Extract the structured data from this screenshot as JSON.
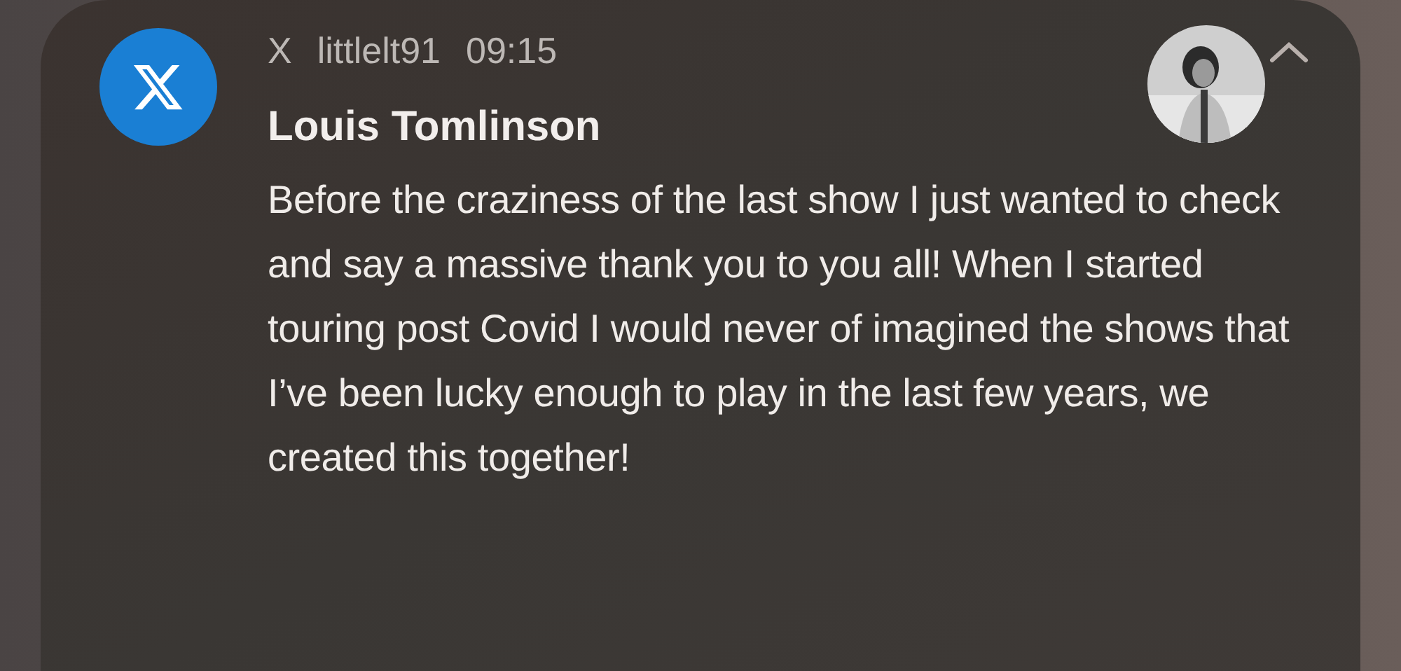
{
  "notification": {
    "app": "X",
    "account": "littlelt91",
    "time": "09:15",
    "title": "Louis Tomlinson",
    "body": "Before the craziness of the last show I just wanted to check and say a massive thank you to you all! When I started touring post Covid I would never of imagined the shows that I’ve been lucky enough to play in the last few years, we created this together!",
    "expanded": true
  }
}
